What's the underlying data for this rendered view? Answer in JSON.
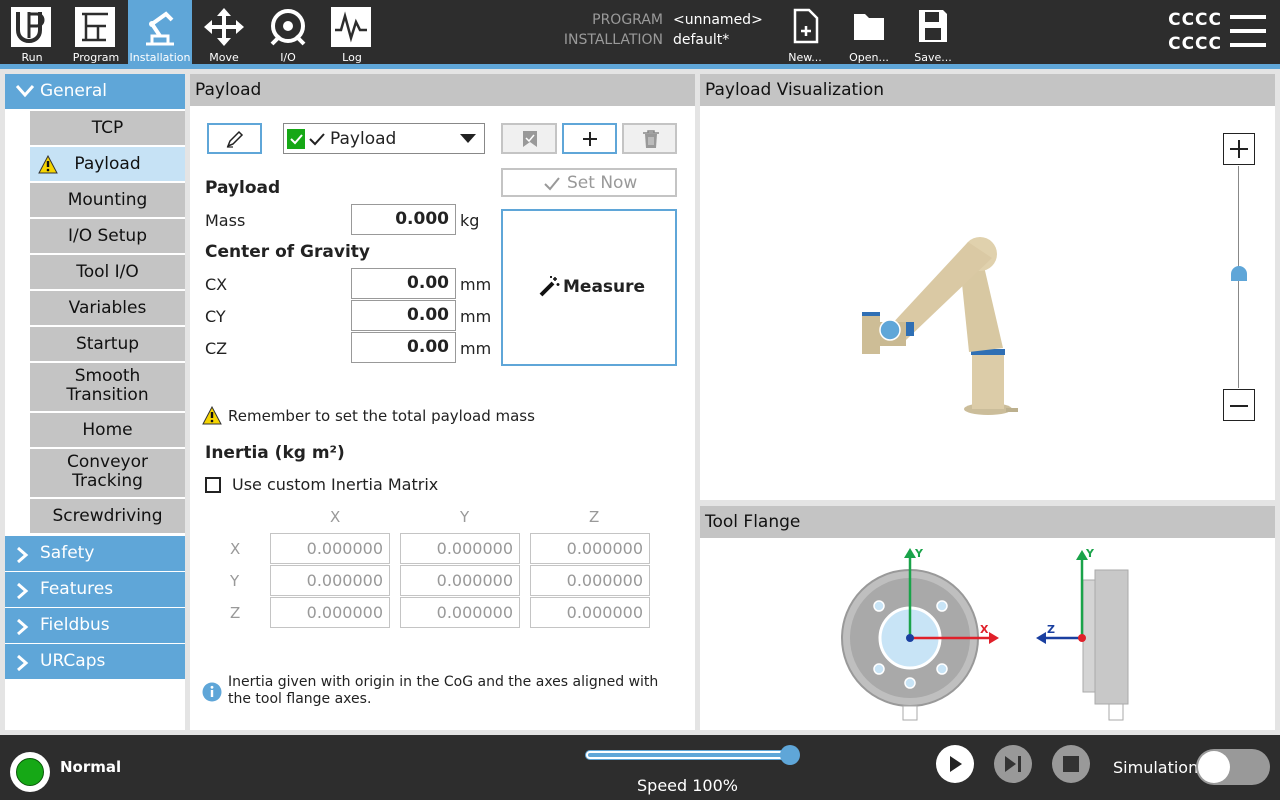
{
  "nav": {
    "run": "Run",
    "program": "Program",
    "installation": "Installation",
    "move": "Move",
    "io": "I/O",
    "log": "Log"
  },
  "header": {
    "program_label": "PROGRAM",
    "program_value": "<unnamed>",
    "installation_label": "INSTALLATION",
    "installation_value": "default*",
    "new": "New...",
    "open": "Open...",
    "save": "Save...",
    "user_line1": "CCCC",
    "user_line2": "CCCC"
  },
  "sidebar": {
    "general": "General",
    "items": [
      "TCP",
      "Payload",
      "Mounting",
      "I/O Setup",
      "Tool I/O",
      "Variables",
      "Startup",
      "Smooth Transition",
      "Home",
      "Conveyor Tracking",
      "Screwdriving"
    ],
    "smooth1": "Smooth",
    "smooth2": "Transition",
    "conveyor1": "Conveyor",
    "conveyor2": "Tracking",
    "safety": "Safety",
    "features": "Features",
    "fieldbus": "Fieldbus",
    "urcaps": "URCaps"
  },
  "payload": {
    "panel_title": "Payload",
    "dropdown_value": "Payload",
    "set_now": "Set Now",
    "section_title": "Payload",
    "mass_label": "Mass",
    "mass_value": "0.000",
    "mass_unit": "kg",
    "cog_title": "Center of Gravity",
    "cx_label": "CX",
    "cy_label": "CY",
    "cz_label": "CZ",
    "cx_value": "0.00",
    "cy_value": "0.00",
    "cz_value": "0.00",
    "unit_mm": "mm",
    "measure": "Measure",
    "warning": "Remember to set the total payload mass",
    "inertia_title": "Inertia (kg m²)",
    "custom_inertia": "Use custom Inertia Matrix",
    "col_x": "X",
    "col_y": "Y",
    "col_z": "Z",
    "row_x": "X",
    "row_y": "Y",
    "row_z": "Z",
    "matrix_value": "0.000000",
    "info": "Inertia given with origin in the CoG and the axes aligned with the tool flange axes."
  },
  "visualization": {
    "title": "Payload Visualization",
    "zoom_level": 0.47
  },
  "flange": {
    "title": "Tool Flange",
    "y": "Y",
    "x": "X",
    "z": "Z"
  },
  "footer": {
    "status": "Normal",
    "speed": "Speed 100%",
    "speed_fraction": 1.0,
    "simulation": "Simulation"
  },
  "colors": {
    "accent": "#5fa6d8",
    "status_green": "#16a816",
    "warning_yellow": "#f5d400",
    "axis_y": "#1aa34a",
    "axis_x": "#e0202a",
    "axis_z": "#1a3fa0"
  }
}
